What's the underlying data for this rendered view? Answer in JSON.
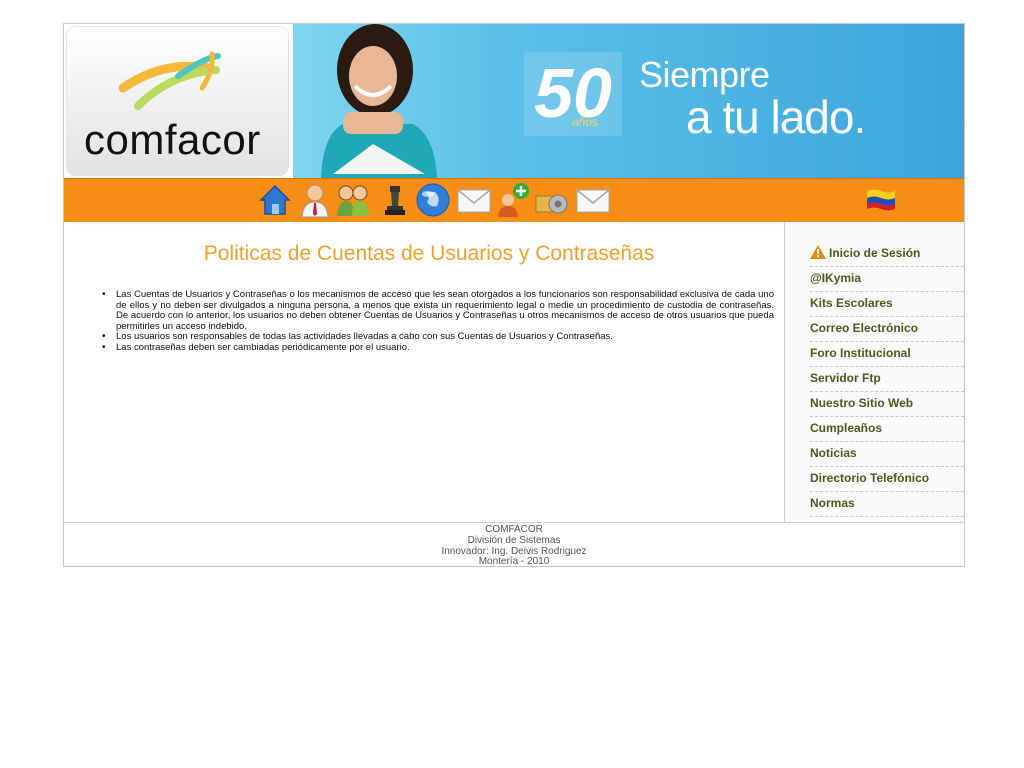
{
  "header": {
    "logo_text": "comfacor",
    "banner": {
      "badge_number": "50",
      "badge_sub": "años",
      "slogan_line1": "Siempre",
      "slogan_line2": "a tu lado."
    }
  },
  "navbar": {
    "icons": [
      "home-icon",
      "user-icon",
      "users-icon",
      "chess-pawn-icon",
      "globe-icon",
      "mail-icon",
      "add-user-icon",
      "settings-icon",
      "mail-icon"
    ],
    "flag": "colombia-flag-icon",
    "color": "#f68d14"
  },
  "content": {
    "title": "Politicas de Cuentas de Usuarios y Contraseñas",
    "items": [
      "Las Cuentas de Usuarios y Contraseñas o los mecanismos de acceso que les sean otorgados a los funcionarios son responsabilidad exclusiva de cada uno de ellos y no deben ser divulgados a ninguna persona, a menos que exista un requerimiento legal o medie un procedimiento de custodia de contraseñas. De acuerdo con lo anterior, los usuarios no deben obtener Cuentas de Usuarios y Contraseñas u otros mecanismos de acceso de otros usuarios que pueda permitirles un acceso indebido.",
      "Los usuarios son responsables de todas las actividades llevadas a cabo con sus Cuentas de Usuarios y Contraseñas.",
      "Las contraseñas deben ser cambiadas periódicamente por el usuario."
    ],
    "title_color": "#f5a02b"
  },
  "sidebar": {
    "items": [
      {
        "label": "Inicio de Sesión",
        "icon": "warning-icon"
      },
      {
        "label": "@IKymia"
      },
      {
        "label": "Kits Escolares"
      },
      {
        "label": "Correo Electrónico"
      },
      {
        "label": "Foro Institucional"
      },
      {
        "label": "Servidor Ftp"
      },
      {
        "label": "Nuestro Sitio Web"
      },
      {
        "label": "Cumpleaños"
      },
      {
        "label": "Noticias"
      },
      {
        "label": "Directorio Telefónico"
      },
      {
        "label": "Normas"
      }
    ],
    "link_color": "#4b5a1e"
  },
  "footer": {
    "line1": "COMFACOR",
    "line2": "División de Sistemas",
    "line3": "Innovador: Ing. Deivis Rodriguez",
    "line4": "Montería - 2010"
  }
}
